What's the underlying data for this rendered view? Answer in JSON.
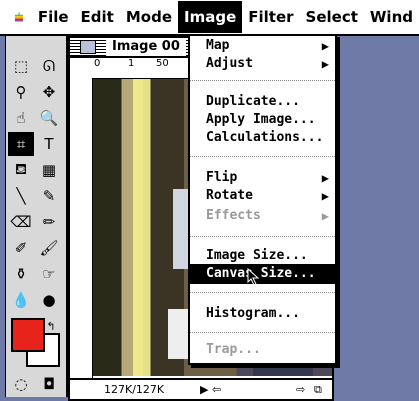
{
  "menubar": {
    "apple_icon": "apple-logo",
    "items": [
      {
        "label": "File"
      },
      {
        "label": "Edit"
      },
      {
        "label": "Mode"
      },
      {
        "label": "Image"
      },
      {
        "label": "Filter"
      },
      {
        "label": "Select"
      },
      {
        "label": "Wind"
      }
    ],
    "active_index": 3
  },
  "image_window": {
    "title": "Image 00",
    "ruler_numbers": [
      "0",
      "1",
      "50"
    ],
    "status_size": "127K/127K"
  },
  "image_menu": {
    "items": [
      {
        "label": "Map",
        "submenu": true,
        "disabled": false
      },
      {
        "label": "Adjust",
        "submenu": true,
        "disabled": false
      },
      {
        "separator": true
      },
      {
        "label": "Duplicate...",
        "submenu": false,
        "disabled": false
      },
      {
        "label": "Apply Image...",
        "submenu": false,
        "disabled": false
      },
      {
        "label": "Calculations...",
        "submenu": false,
        "disabled": false
      },
      {
        "separator": true
      },
      {
        "label": "Flip",
        "submenu": true,
        "disabled": false
      },
      {
        "label": "Rotate",
        "submenu": true,
        "disabled": false
      },
      {
        "label": "Effects",
        "submenu": true,
        "disabled": true
      },
      {
        "separator": true
      },
      {
        "label": "Image Size...",
        "submenu": false,
        "disabled": false
      },
      {
        "label": "Canvas Size...",
        "submenu": false,
        "disabled": false,
        "highlighted": true
      },
      {
        "separator": true
      },
      {
        "label": "Histogram...",
        "submenu": false,
        "disabled": false
      },
      {
        "separator": true
      },
      {
        "label": "Trap...",
        "submenu": false,
        "disabled": true
      }
    ]
  },
  "colors": {
    "foreground": "#e8231c",
    "background": "#ffffff",
    "desktop": "#6f7aa6"
  }
}
